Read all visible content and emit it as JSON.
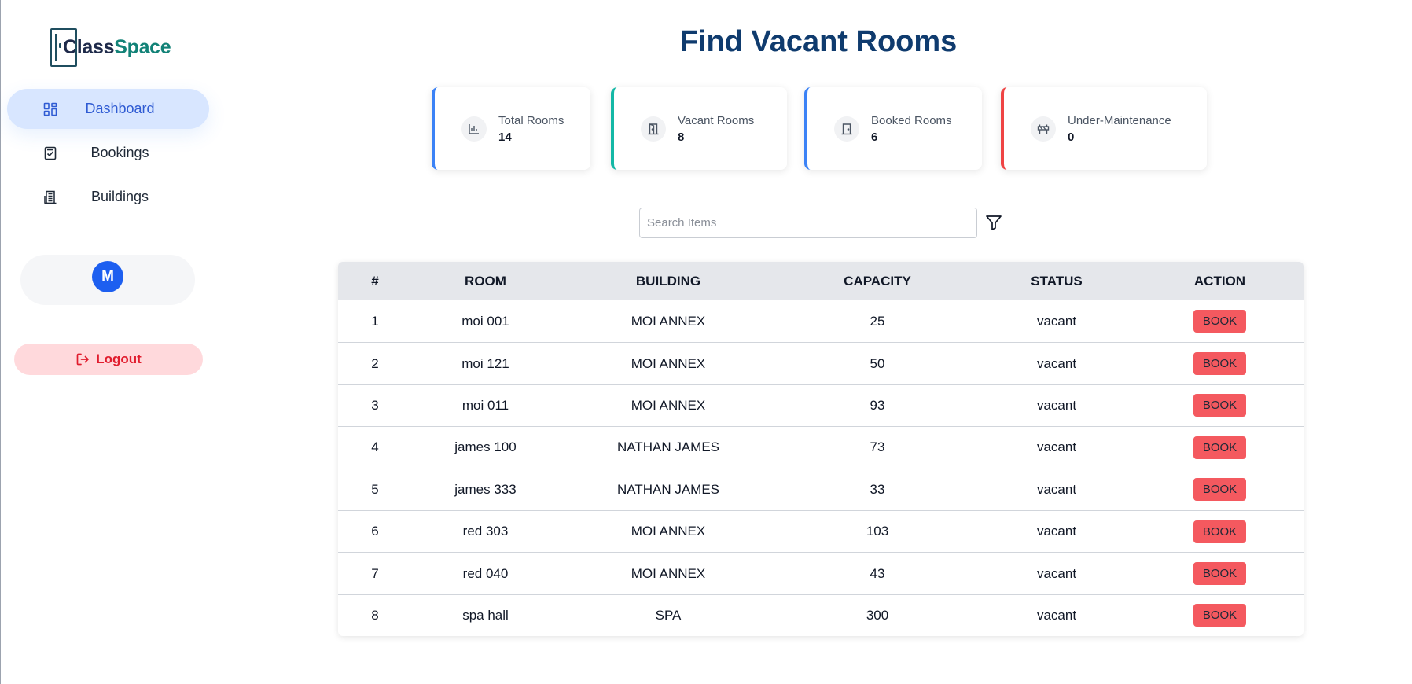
{
  "app": {
    "logo_part1": "Class",
    "logo_part2": "Space"
  },
  "sidebar": {
    "items": [
      {
        "label": "Dashboard",
        "icon": "dashboard-grid-icon",
        "active": true
      },
      {
        "label": "Bookings",
        "icon": "clipboard-check-icon",
        "active": false
      },
      {
        "label": "Buildings",
        "icon": "building-icon",
        "active": false
      }
    ],
    "avatar_initial": "M",
    "logout_label": "Logout"
  },
  "page": {
    "title": "Find Vacant Rooms"
  },
  "stats": [
    {
      "label": "Total Rooms",
      "value": "14",
      "accent": "#3b82f6",
      "icon": "bar-chart-icon"
    },
    {
      "label": "Vacant Rooms",
      "value": "8",
      "accent": "#14b8a6",
      "icon": "open-door-icon"
    },
    {
      "label": "Booked Rooms",
      "value": "6",
      "accent": "#3b82f6",
      "icon": "closed-door-icon"
    },
    {
      "label": "Under-Maintenance",
      "value": "0",
      "accent": "#ef4444",
      "icon": "barrier-icon"
    }
  ],
  "search": {
    "placeholder": "Search Items",
    "value": ""
  },
  "table": {
    "headers": [
      "#",
      "ROOM",
      "BUILDING",
      "CAPACITY",
      "STATUS",
      "ACTION"
    ],
    "rows": [
      {
        "num": "1",
        "room": "moi 001",
        "building": "MOI ANNEX",
        "capacity": "25",
        "status": "vacant",
        "action": "BOOK"
      },
      {
        "num": "2",
        "room": "moi 121",
        "building": "MOI ANNEX",
        "capacity": "50",
        "status": "vacant",
        "action": "BOOK"
      },
      {
        "num": "3",
        "room": "moi 011",
        "building": "MOI ANNEX",
        "capacity": "93",
        "status": "vacant",
        "action": "BOOK"
      },
      {
        "num": "4",
        "room": "james 100",
        "building": "NATHAN JAMES",
        "capacity": "73",
        "status": "vacant",
        "action": "BOOK"
      },
      {
        "num": "5",
        "room": "james 333",
        "building": "NATHAN JAMES",
        "capacity": "33",
        "status": "vacant",
        "action": "BOOK"
      },
      {
        "num": "6",
        "room": "red 303",
        "building": "MOI ANNEX",
        "capacity": "103",
        "status": "vacant",
        "action": "BOOK"
      },
      {
        "num": "7",
        "room": "red 040",
        "building": "MOI ANNEX",
        "capacity": "43",
        "status": "vacant",
        "action": "BOOK"
      },
      {
        "num": "8",
        "room": "spa hall",
        "building": "SPA",
        "capacity": "300",
        "status": "vacant",
        "action": "BOOK"
      }
    ]
  },
  "colors": {
    "title": "#0f3b6e",
    "active_nav_bg": "#d8e6ff",
    "book_button": "#f4595f",
    "logout_text": "#e11d2e",
    "avatar": "#1d5ff0"
  }
}
